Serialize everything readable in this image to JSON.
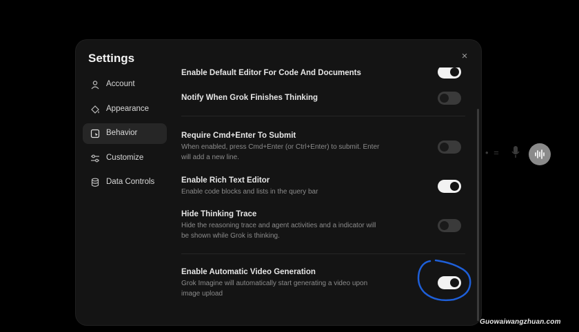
{
  "modal": {
    "title": "Settings",
    "close": "×"
  },
  "sidebar": {
    "items": [
      {
        "label": "Account",
        "icon": "person-icon",
        "active": false
      },
      {
        "label": "Appearance",
        "icon": "paint-bucket-icon",
        "active": false
      },
      {
        "label": "Behavior",
        "icon": "cursor-window-icon",
        "active": true
      },
      {
        "label": "Customize",
        "icon": "sliders-icon",
        "active": false
      },
      {
        "label": "Data Controls",
        "icon": "database-icon",
        "active": false
      }
    ]
  },
  "settings": [
    {
      "title": "Enable Default Editor For Code And Documents",
      "description": "",
      "enabled": true
    },
    {
      "title": "Notify When Grok Finishes Thinking",
      "description": "",
      "enabled": false
    },
    {
      "title": "Require Cmd+Enter To Submit",
      "description": "When enabled, press Cmd+Enter (or Ctrl+Enter) to submit. Enter will add a new line.",
      "enabled": false
    },
    {
      "title": "Enable Rich Text Editor",
      "description": "Enable code blocks and lists in the query bar",
      "enabled": true
    },
    {
      "title": "Hide Thinking Trace",
      "description": "Hide the reasoning trace and agent activities and a indicator will be shown while Grok is thinking.",
      "enabled": false
    },
    {
      "title": "Enable Automatic Video Generation",
      "description": "Grok Imagine will automatically start generating a video upon image upload",
      "enabled": true
    }
  ],
  "watermark": "Guowaiwangzhuan.com",
  "colors": {
    "modal_bg": "#141414",
    "active_nav": "#262626",
    "toggle_on": "#f2f2f2",
    "toggle_off": "#3a3a3a",
    "annotation": "#1e5fd8"
  }
}
